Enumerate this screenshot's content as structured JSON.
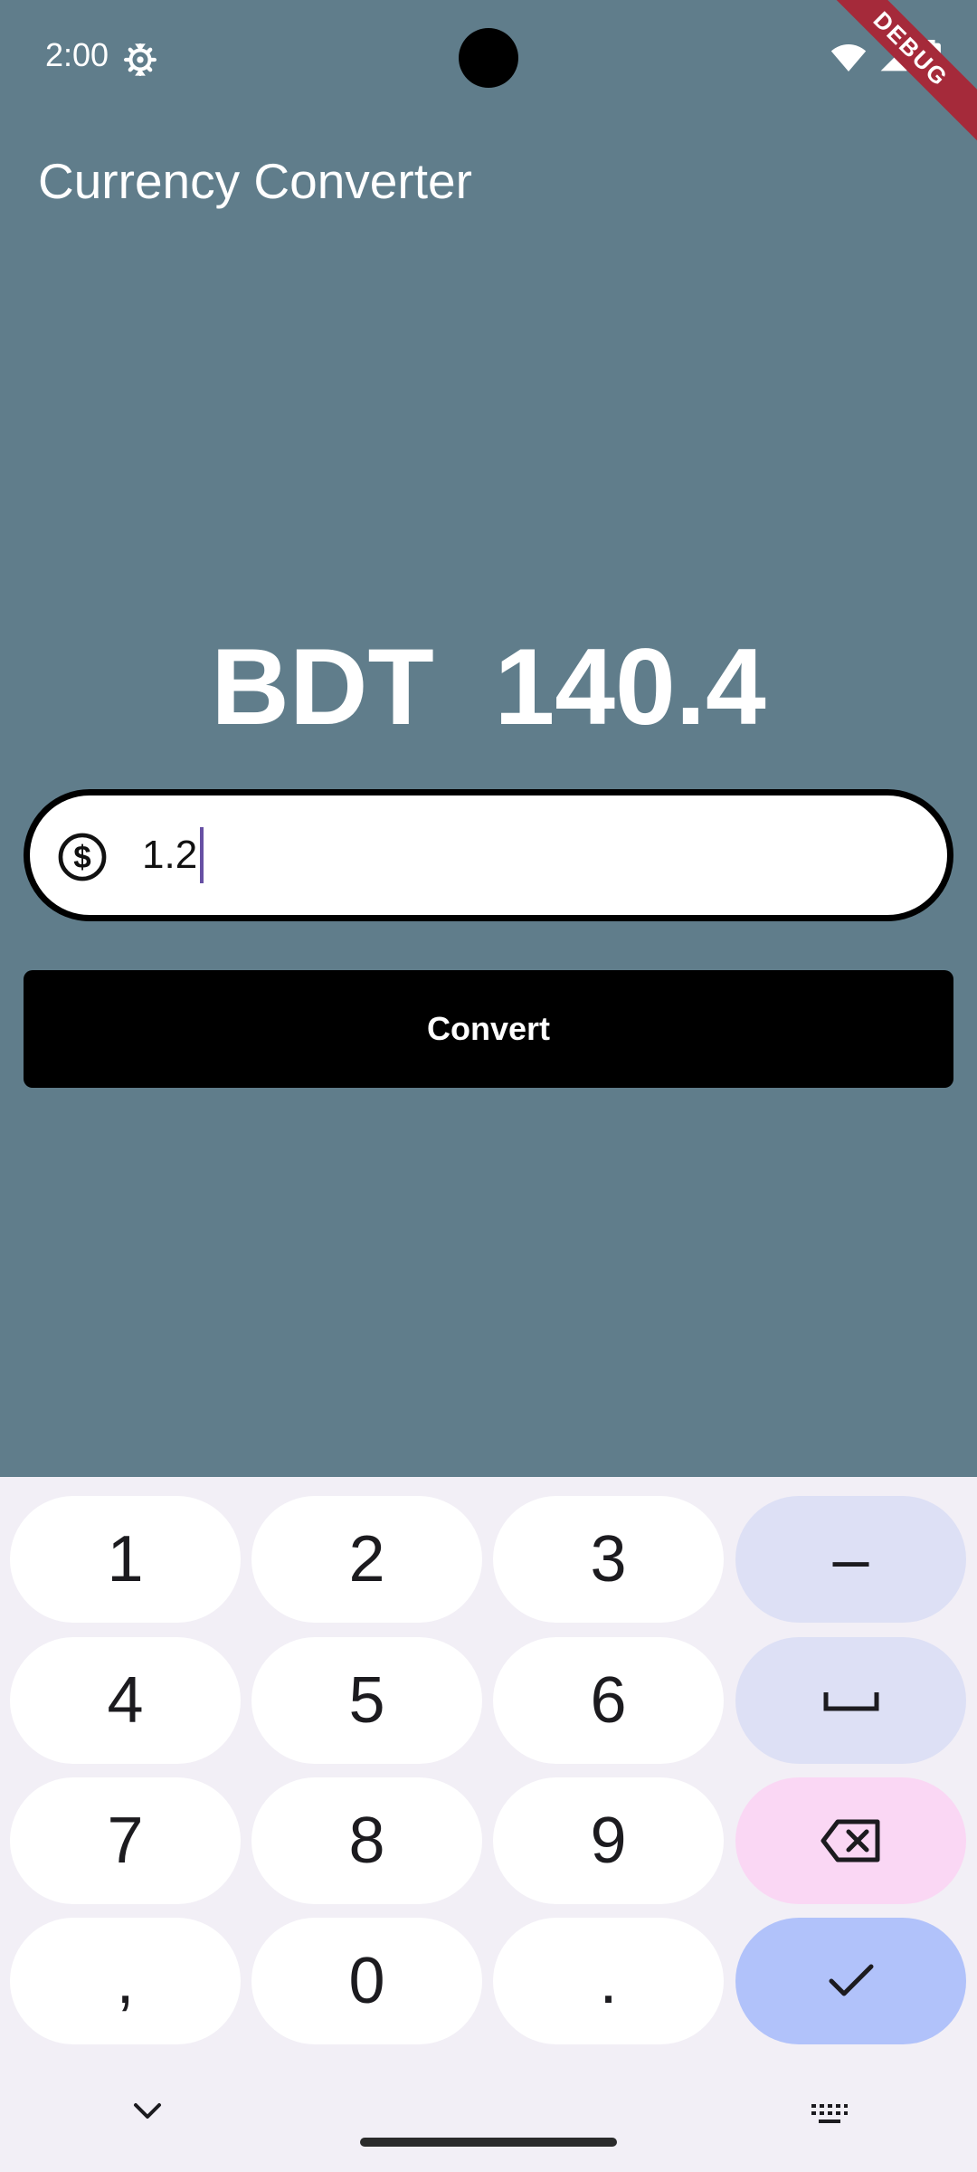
{
  "status_bar": {
    "time": "2:00",
    "icons": [
      "settings-icon",
      "wifi-icon",
      "signal-icon",
      "battery-icon"
    ],
    "debug_banner": "DEBUG"
  },
  "app": {
    "title": "Currency Converter",
    "result": "BDT  140.4",
    "input": {
      "value": "1.2",
      "icon": "dollar-circle-icon"
    },
    "convert_label": "Convert"
  },
  "keyboard": {
    "rows": [
      [
        "1",
        "2",
        "3",
        "–"
      ],
      [
        "4",
        "5",
        "6",
        "space"
      ],
      [
        "7",
        "8",
        "9",
        "backspace"
      ],
      [
        ",",
        "0",
        ".",
        "done"
      ]
    ],
    "bottom_icons": [
      "chevron-down-icon",
      "keyboard-icon"
    ]
  },
  "colors": {
    "background": "#607d8b",
    "button": "#000000",
    "caret": "#6750a4",
    "debug_banner": "#a52a3a"
  }
}
